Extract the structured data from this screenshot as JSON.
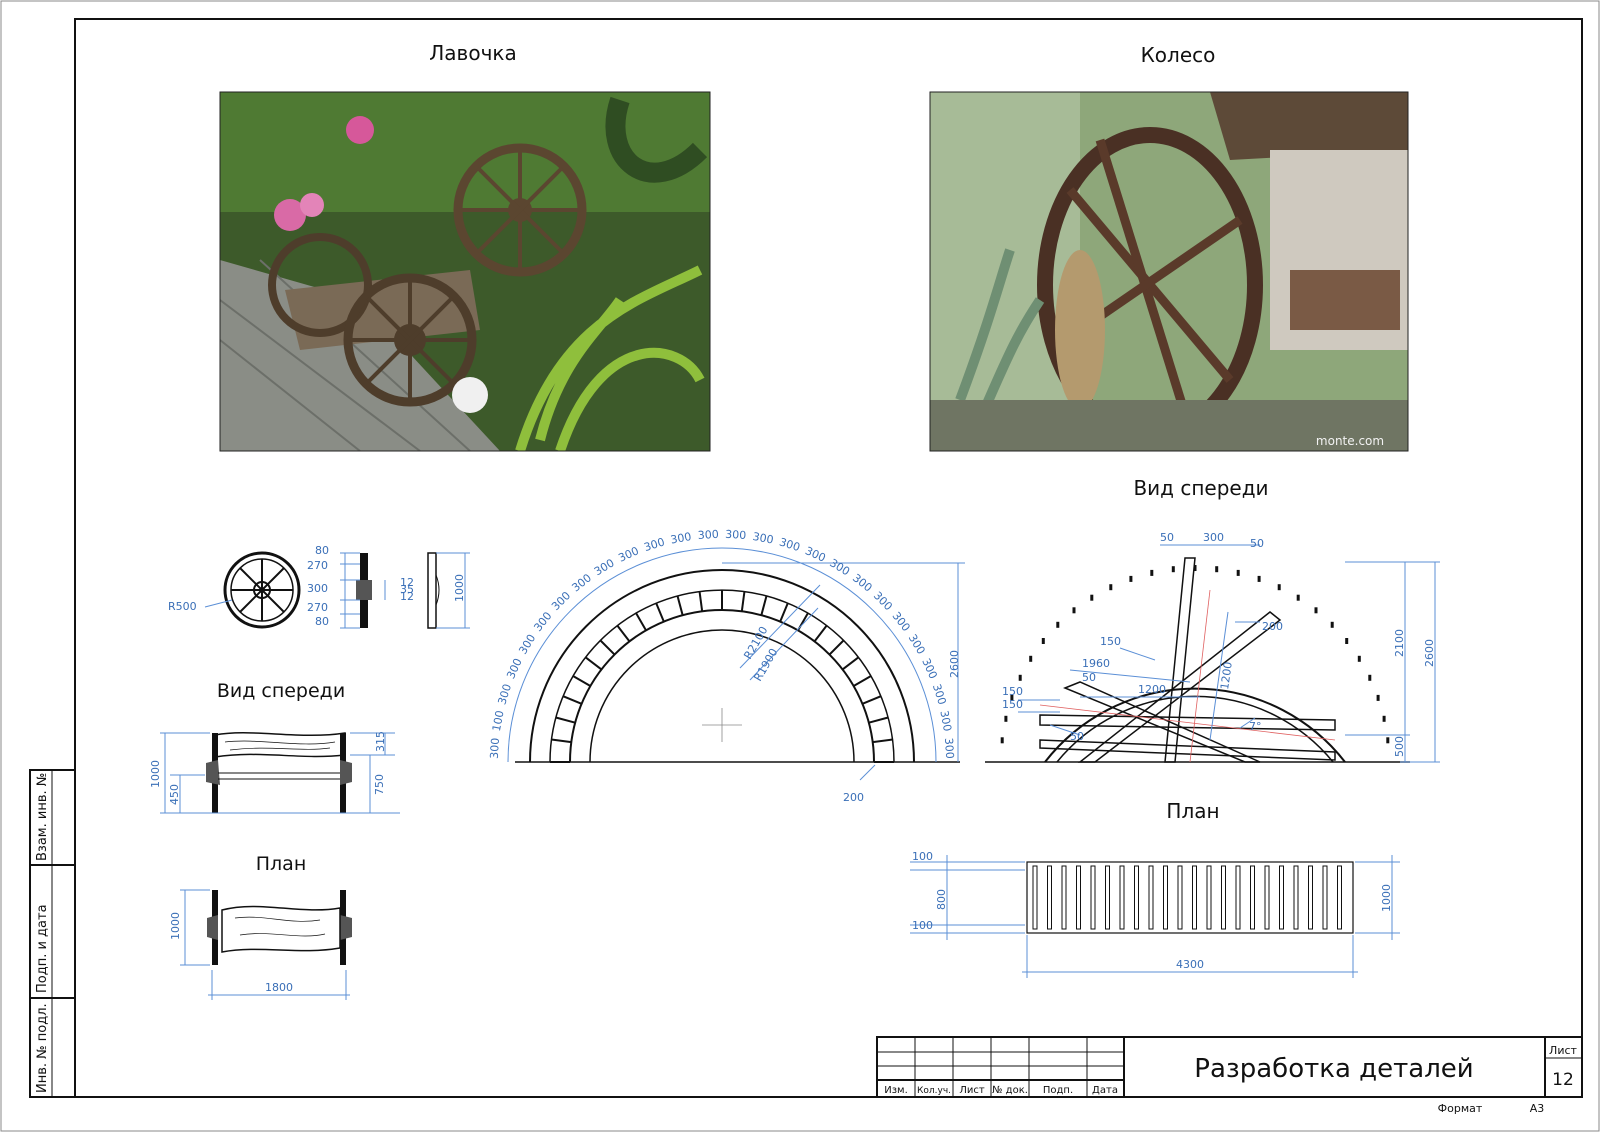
{
  "sheet": {
    "title_block": {
      "title": "Разработка деталей",
      "sheet_label": "Лист",
      "sheet_number": "12",
      "format_label": "Формат",
      "format_value": "А3",
      "columns": [
        "Изм.",
        "Кол.уч.",
        "Лист",
        "№ док.",
        "Подп.",
        "Дата"
      ]
    },
    "side_stamp": [
      "Инв. № подл.",
      "Подп. и дата",
      "Взам. инв. №"
    ]
  },
  "bench": {
    "title": "Лавочка",
    "wheel": {
      "radius": "R500",
      "dims": [
        "80",
        "270",
        "300",
        "270",
        "80"
      ],
      "small_dims": [
        "12",
        "35",
        "12"
      ],
      "side_dim": "1000"
    },
    "front_view": {
      "title": "Вид спереди",
      "dims": [
        "1000",
        "450",
        "315",
        "750"
      ]
    },
    "plan": {
      "title": "План",
      "dims": [
        "1000",
        "1800"
      ]
    }
  },
  "wheel_section": {
    "title": "Колесо",
    "watermark": "monte.com",
    "arc": {
      "radii": [
        "R2100",
        "R1900"
      ],
      "spacing": "300",
      "spacing_alt": "100",
      "height": "2600",
      "thickness": "200"
    },
    "front_view": {
      "title": "Вид спереди",
      "dims": [
        "50",
        "300",
        "50",
        "200",
        "150",
        "1960",
        "50",
        "1200",
        "1200",
        "150",
        "150",
        "50",
        "2100",
        "2600",
        "500"
      ],
      "angle": "7°"
    },
    "plan": {
      "title": "План",
      "dims": [
        "100",
        "800",
        "100",
        "1000",
        "4300"
      ]
    }
  }
}
